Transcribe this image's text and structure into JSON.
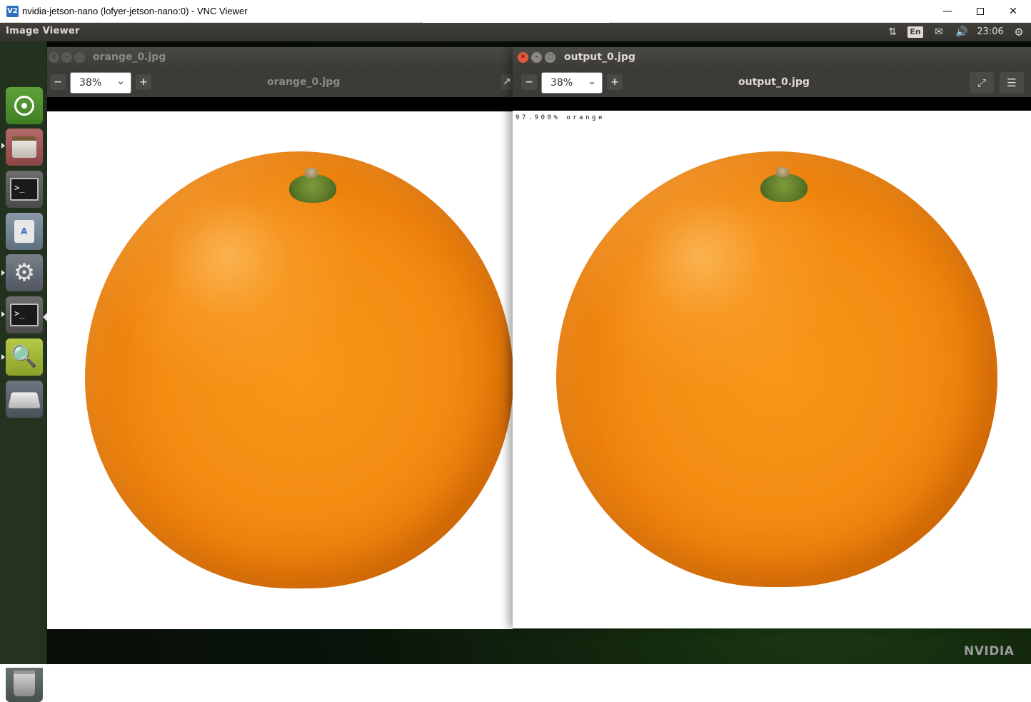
{
  "vnc_window": {
    "app_icon": "V2",
    "title": "nvidia-jetson-nano (lofyer-jetson-nano:0) - VNC Viewer",
    "minimize_icon": "minimize-icon",
    "maximize_icon": "maximize-icon",
    "close_icon": "close-icon"
  },
  "top_panel": {
    "app_name": "Image Viewer",
    "keyboard_layout": "En",
    "clock": "23:06",
    "icons": [
      "network-icon",
      "keyboard-layout-indicator",
      "mail-icon",
      "volume-icon",
      "gear-icon"
    ]
  },
  "launcher": {
    "items": [
      {
        "name": "dash-home",
        "icon": "ubuntu-logo-icon"
      },
      {
        "name": "files",
        "icon": "file-cabinet-icon"
      },
      {
        "name": "terminal",
        "icon": "terminal-icon"
      },
      {
        "name": "software-center",
        "icon": "shopping-bag-icon"
      },
      {
        "name": "system-settings",
        "icon": "gear-wrench-icon"
      },
      {
        "name": "terminal-2",
        "icon": "terminal-icon"
      },
      {
        "name": "image-viewer",
        "icon": "image-viewer-icon"
      },
      {
        "name": "drive",
        "icon": "drive-icon"
      },
      {
        "name": "trash",
        "icon": "trash-icon"
      }
    ]
  },
  "viewer_left": {
    "window_title": "orange_0.jpg",
    "zoom": "38%",
    "header_title": "orange_0.jpg"
  },
  "viewer_right": {
    "window_title": "output_0.jpg",
    "zoom": "38%",
    "header_title": "output_0.jpg",
    "detection_label": "97.900% orange"
  },
  "desktop": {
    "brand": "NVIDIA"
  }
}
